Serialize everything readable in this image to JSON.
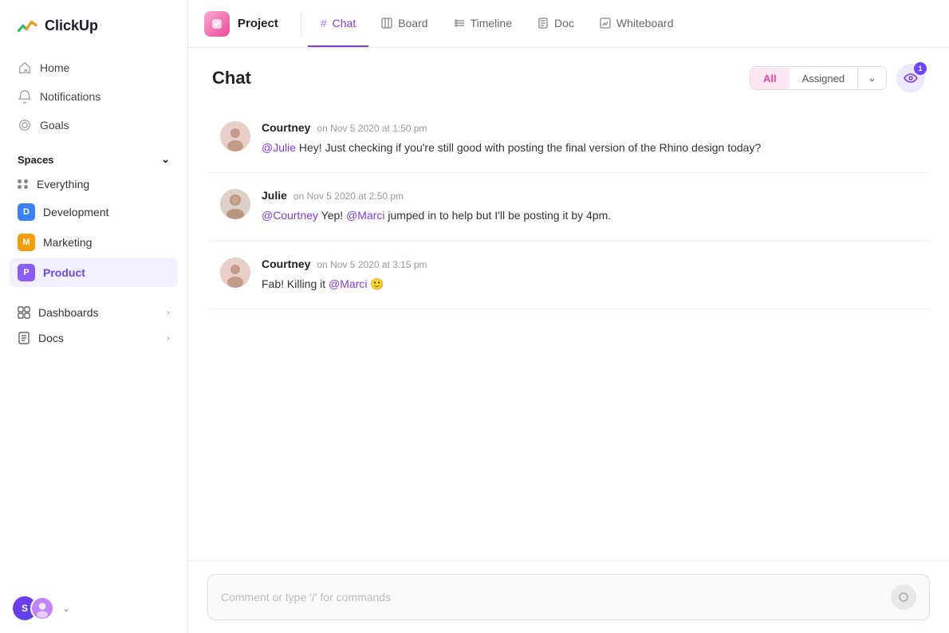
{
  "app": {
    "name": "ClickUp"
  },
  "sidebar": {
    "nav": [
      {
        "id": "home",
        "label": "Home",
        "icon": "home"
      },
      {
        "id": "notifications",
        "label": "Notifications",
        "icon": "bell"
      },
      {
        "id": "goals",
        "label": "Goals",
        "icon": "trophy"
      }
    ],
    "spaces_label": "Spaces",
    "spaces": [
      {
        "id": "everything",
        "label": "Everything",
        "type": "grid"
      },
      {
        "id": "development",
        "label": "Development",
        "color": "#3b82f6",
        "letter": "D"
      },
      {
        "id": "marketing",
        "label": "Marketing",
        "color": "#f59e0b",
        "letter": "M"
      },
      {
        "id": "product",
        "label": "Product",
        "color": "#8b5cf6",
        "letter": "P",
        "active": true
      }
    ],
    "sections": [
      {
        "id": "dashboards",
        "label": "Dashboards",
        "has_arrow": true
      },
      {
        "id": "docs",
        "label": "Docs",
        "has_arrow": true
      }
    ],
    "user_initial": "S"
  },
  "header": {
    "project_label": "Project",
    "tabs": [
      {
        "id": "chat",
        "label": "Chat",
        "icon": "#",
        "active": true
      },
      {
        "id": "board",
        "label": "Board",
        "icon": "board"
      },
      {
        "id": "timeline",
        "label": "Timeline",
        "icon": "timeline"
      },
      {
        "id": "doc",
        "label": "Doc",
        "icon": "doc"
      },
      {
        "id": "whiteboard",
        "label": "Whiteboard",
        "icon": "whiteboard"
      }
    ]
  },
  "chat": {
    "title": "Chat",
    "filter_all": "All",
    "filter_assigned": "Assigned",
    "eye_badge": "1",
    "messages": [
      {
        "id": "msg1",
        "author": "Courtney",
        "time": "on Nov 5 2020 at 1:50 pm",
        "mention": "@Julie",
        "text_before": "",
        "text_after": " Hey! Just checking if you're still good with posting the final version of the Rhino design today?"
      },
      {
        "id": "msg2",
        "author": "Julie",
        "time": "on Nov 5 2020 at 2:50 pm",
        "mention": "@Courtney",
        "text_after": " Yep! ",
        "mention2": "@Marci",
        "text_after2": " jumped in to help but I'll be posting it by 4pm."
      },
      {
        "id": "msg3",
        "author": "Courtney",
        "time": "on Nov 5 2020 at 3:15 pm",
        "text_before": "Fab! Killing it ",
        "mention": "@Marci",
        "emoji": "🙂"
      }
    ],
    "comment_placeholder": "Comment or type '/' for commands"
  }
}
